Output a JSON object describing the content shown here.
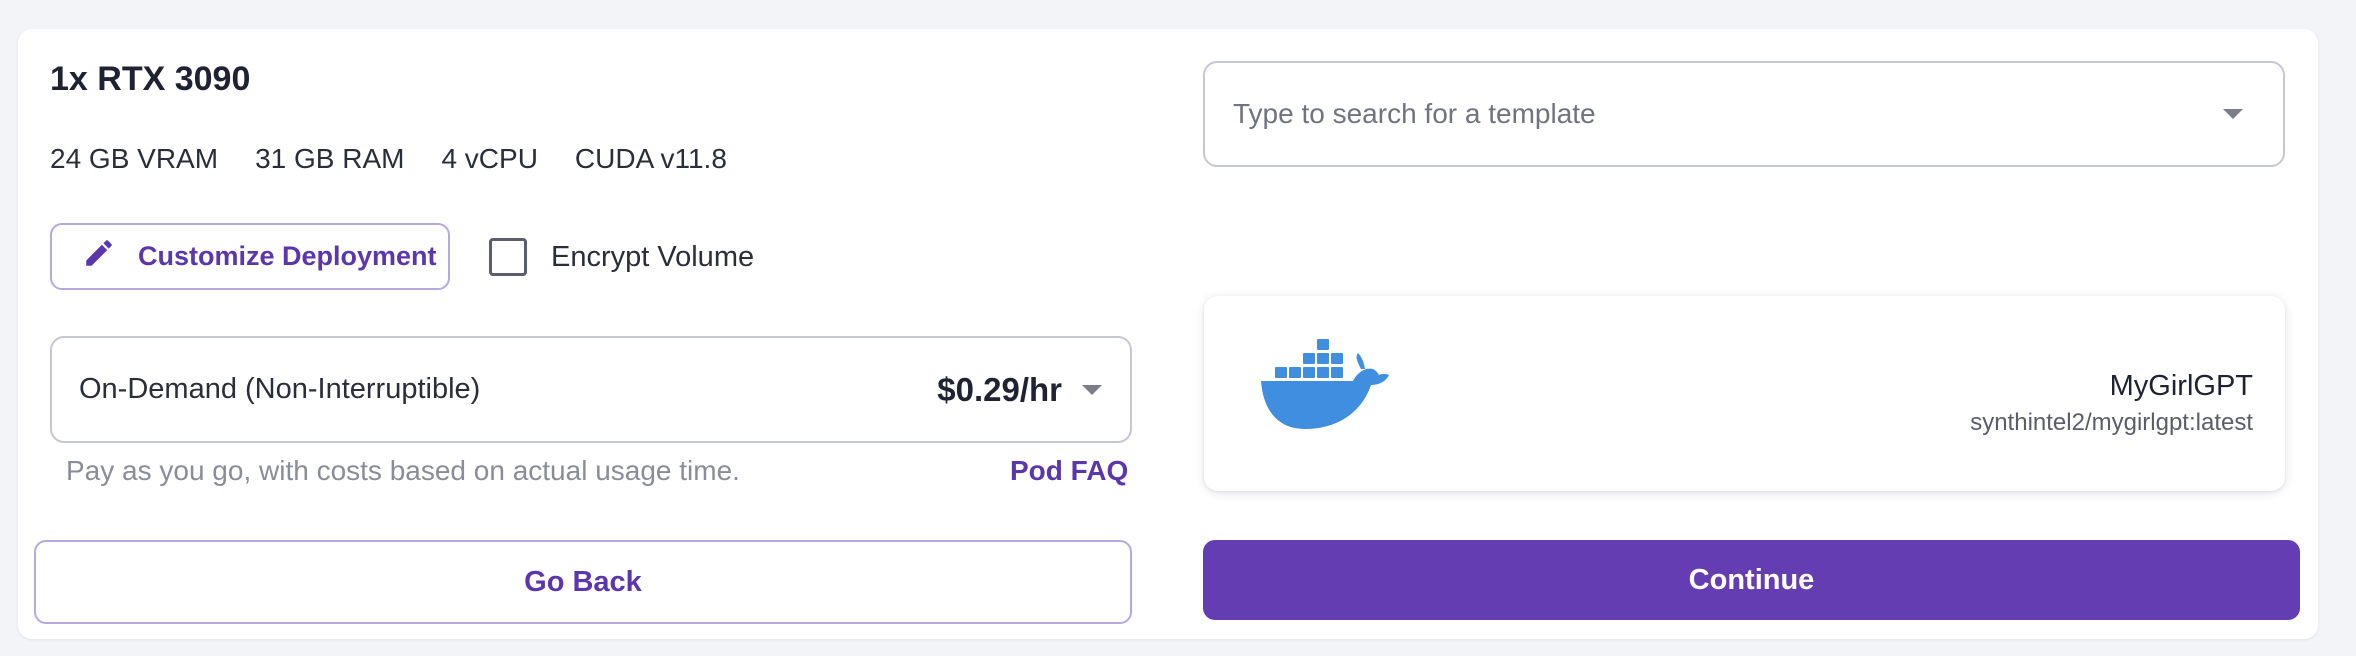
{
  "gpu": {
    "title": "1x RTX 3090",
    "specs": [
      "24 GB VRAM",
      "31 GB RAM",
      "4 vCPU",
      "CUDA v11.8"
    ]
  },
  "customize": {
    "label": "Customize Deployment",
    "icon": "pencil-icon"
  },
  "encrypt": {
    "label": "Encrypt Volume",
    "checked": false
  },
  "pricing": {
    "selected": "On-Demand (Non-Interruptible)",
    "price": "$0.29/hr",
    "help": "Pay as you go, with costs based on actual usage time.",
    "faq_label": "Pod FAQ"
  },
  "template_search": {
    "placeholder": "Type to search for a template",
    "value": ""
  },
  "template": {
    "name": "MyGirlGPT",
    "image": "synthintel2/mygirlgpt:latest",
    "icon": "docker-icon"
  },
  "actions": {
    "go_back": "Go Back",
    "continue": "Continue"
  },
  "colors": {
    "accent": "#643db2",
    "accent_text": "#5b36ad",
    "accent_border": "#b6a8e0",
    "docker_blue": "#3f8ee0",
    "background": "#f3f4f8"
  }
}
